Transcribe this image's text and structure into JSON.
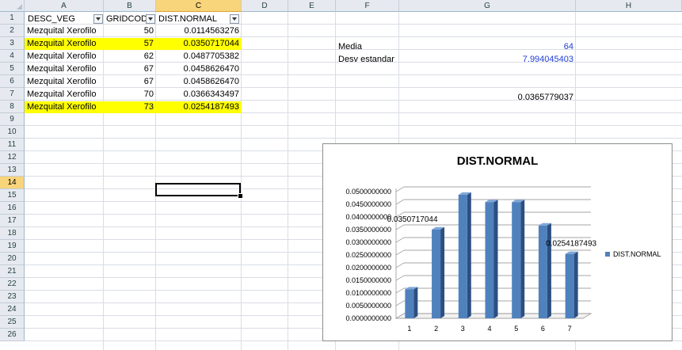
{
  "columns": [
    "A",
    "B",
    "C",
    "D",
    "E",
    "F",
    "G",
    "H"
  ],
  "active_column": "C",
  "rows": [
    "1",
    "2",
    "3",
    "4",
    "5",
    "6",
    "7",
    "8",
    "9",
    "10",
    "11",
    "12",
    "13",
    "14",
    "15",
    "16",
    "17",
    "18",
    "19",
    "20",
    "21",
    "22",
    "23",
    "24",
    "25",
    "26"
  ],
  "active_row": "14",
  "headers": {
    "a": "DESC_VEG",
    "b": "GRIDCODE",
    "c": "DIST.NORMAL"
  },
  "data_rows": [
    {
      "desc": "Mezquital Xerofilo",
      "grid": "50",
      "dist": "0.0114563276",
      "highlight": false
    },
    {
      "desc": "Mezquital Xerofilo",
      "grid": "57",
      "dist": "0.0350717044",
      "highlight": true
    },
    {
      "desc": "Mezquital Xerofilo",
      "grid": "62",
      "dist": "0.0487705382",
      "highlight": false
    },
    {
      "desc": "Mezquital Xerofilo",
      "grid": "67",
      "dist": "0.0458626470",
      "highlight": false
    },
    {
      "desc": "Mezquital Xerofilo",
      "grid": "67",
      "dist": "0.0458626470",
      "highlight": false
    },
    {
      "desc": "Mezquital Xerofilo",
      "grid": "70",
      "dist": "0.0366343497",
      "highlight": false
    },
    {
      "desc": "Mezquital Xerofilo",
      "grid": "73",
      "dist": "0.0254187493",
      "highlight": true
    }
  ],
  "stats": {
    "media_label": "Media",
    "media_value": "64",
    "desv_label": "Desv estandar",
    "desv_value": "7.994045403",
    "extra_value": "0.0365779037"
  },
  "colors": {
    "bar": "#4f81bd",
    "highlight": "#ffff00",
    "stat_value": "#1f3fd6"
  },
  "chart_data": {
    "type": "bar",
    "title": "DIST.NORMAL",
    "categories": [
      "1",
      "2",
      "3",
      "4",
      "5",
      "6",
      "7"
    ],
    "series": [
      {
        "name": "DIST.NORMAL",
        "values": [
          0.0114563276,
          0.0350717044,
          0.0487705382,
          0.045862647,
          0.045862647,
          0.0366343497,
          0.0254187493
        ]
      }
    ],
    "data_labels": [
      {
        "index": 1,
        "text": "0.0350717044"
      },
      {
        "index": 6,
        "text": "0.0254187493"
      }
    ],
    "y_ticks": [
      "0.0000000000",
      "0.0050000000",
      "0.0100000000",
      "0.0150000000",
      "0.0200000000",
      "0.0250000000",
      "0.0300000000",
      "0.0350000000",
      "0.0400000000",
      "0.0450000000",
      "0.0500000000"
    ],
    "ylim": [
      0,
      0.05
    ],
    "grid": true,
    "legend": "right",
    "style": "3d-column"
  }
}
